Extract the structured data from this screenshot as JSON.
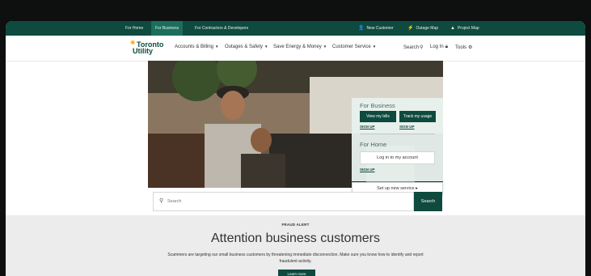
{
  "topbar": {
    "tabs": [
      "For Home",
      "For Business",
      "For Contractors & Developers"
    ],
    "active_tab": "For Business",
    "right_links": [
      {
        "icon": "new-customer-icon",
        "label": "New Customer"
      },
      {
        "icon": "outage-bolt-icon",
        "label": "Outage Map"
      },
      {
        "icon": "project-map-icon",
        "label": "Project Map"
      }
    ]
  },
  "logo": {
    "line1": "Toronto",
    "line2": "Utility"
  },
  "nav": {
    "items": [
      "Accounts & Billing",
      "Outages & Safety",
      "Save Energy & Money",
      "Customer Service"
    ],
    "search_label": "Search",
    "login_label": "Log In",
    "tools_label": "Tools"
  },
  "hero_card": {
    "business_heading": "For Business",
    "view_bills": "View my bills",
    "track_usage": "Track my usage",
    "sign_up_1": "SIGN UP",
    "sign_up_2": "SIGN UP",
    "home_heading": "For Home",
    "login_account": "Log in to my account",
    "sign_up_3": "SIGN UP",
    "setup_service": "Set up new service ▸"
  },
  "search": {
    "placeholder": "Search",
    "button": "Search"
  },
  "fraud": {
    "label": "FRAUD ALERT",
    "headline": "Attention business customers",
    "body": "Scammers are targeting our small business customers by threatening immediate disconnection. Make sure you know how to identify and report fraudulent activity.",
    "button": "Learn more"
  },
  "colors": {
    "brand": "#0e4a3e",
    "accent": "#f2b01e",
    "active_tab": "#1b6e5c"
  }
}
